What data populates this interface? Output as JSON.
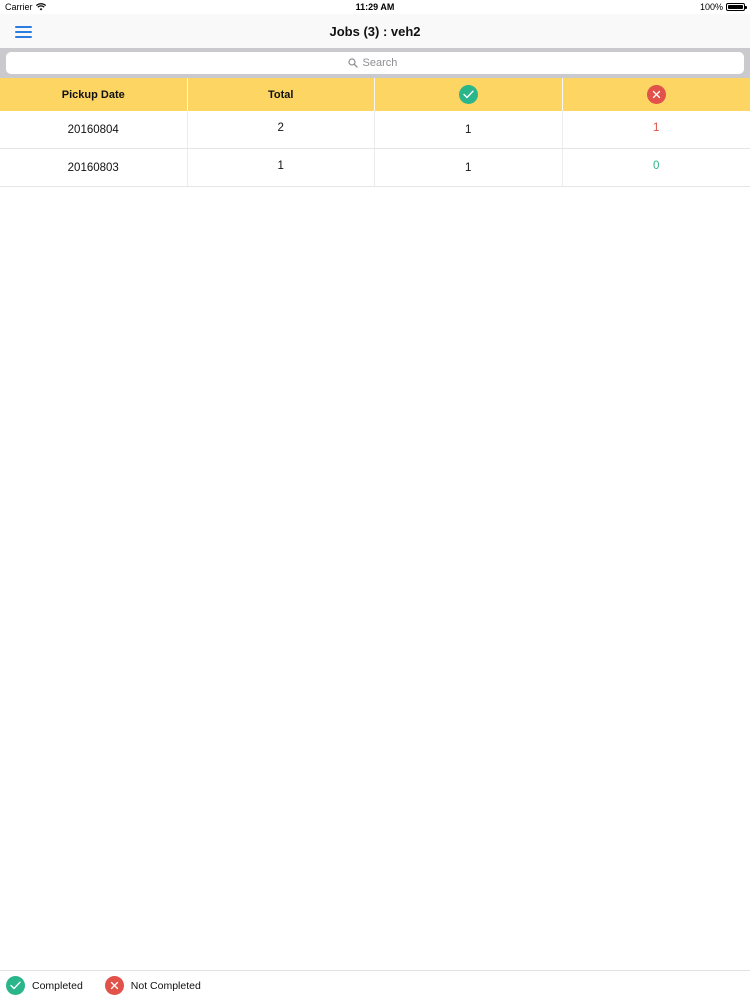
{
  "status_bar": {
    "carrier": "Carrier",
    "time": "11:29 AM",
    "battery": "100%",
    "battery_level": 1.0
  },
  "nav": {
    "title": "Jobs (3) : veh2",
    "menu_icon": "hamburger-menu-icon"
  },
  "search": {
    "placeholder": "Search",
    "value": ""
  },
  "table": {
    "headers": {
      "pickup_date": "Pickup Date",
      "total": "Total",
      "completed_icon": "check-circle-icon",
      "not_completed_icon": "x-circle-icon"
    },
    "rows": [
      {
        "pickup_date": "20160804",
        "total": "2",
        "completed": "1",
        "not_completed": "1"
      },
      {
        "pickup_date": "20160803",
        "total": "1",
        "completed": "1",
        "not_completed": "0"
      }
    ]
  },
  "legend": {
    "completed": "Completed",
    "not_completed": "Not Completed"
  },
  "colors": {
    "accent": "#2a7de1",
    "header_bg": "#fcd563",
    "completed": "#2bb58a",
    "not_completed": "#e0524a"
  }
}
